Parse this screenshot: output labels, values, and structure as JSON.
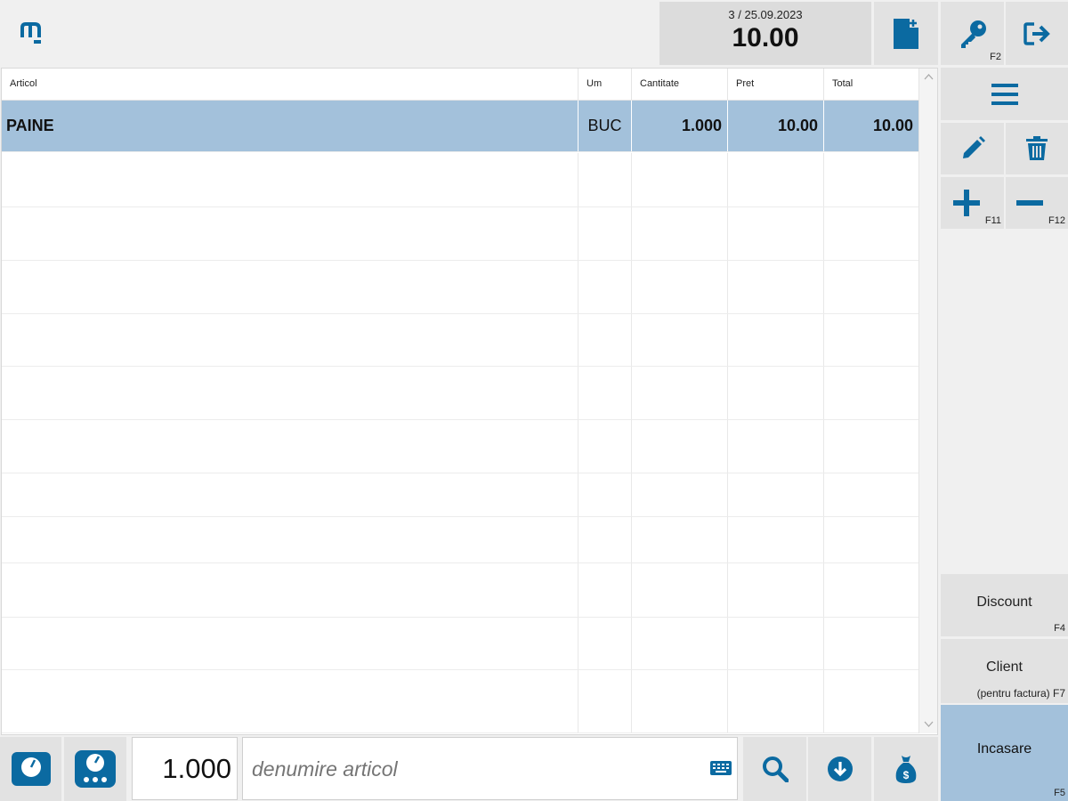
{
  "header": {
    "receipt_info": "3 / 25.09.2023",
    "total": "10.00",
    "logo_icon": "m-logo-icon",
    "new_doc_icon": "new-document-icon",
    "key_icon": "key-icon",
    "key_fkey": "F2",
    "logout_icon": "logout-icon"
  },
  "table": {
    "columns": [
      "Articol",
      "Um",
      "Cantitate",
      "Pret",
      "Total"
    ],
    "rows": [
      {
        "articol": "PAINE",
        "um": "BUC",
        "cantitate": "1.000",
        "pret": "10.00",
        "total": "10.00"
      }
    ]
  },
  "side": {
    "menu_icon": "menu-icon",
    "edit_icon": "pencil-icon",
    "delete_icon": "trash-icon",
    "plus_fkey": "F11",
    "minus_fkey": "F12",
    "discount_label": "Discount",
    "discount_fkey": "F4",
    "client_label": "Client",
    "client_sub": "(pentru factura) F7",
    "incasare_label": "Incasare",
    "incasare_fkey": "F5"
  },
  "bottom": {
    "quantity": "1.000",
    "search_placeholder": "denumire articol",
    "scale_icon": "scale-icon",
    "scale_multi_icon": "scale-multi-icon",
    "keyboard_icon": "keyboard-icon",
    "search_icon": "search-icon",
    "down_icon": "arrow-down-circle-icon",
    "bag_icon": "money-bag-icon"
  },
  "colors": {
    "accent": "#0b6aa1",
    "selected_row": "#a3c1db",
    "incasare_bg": "#a3c1db",
    "button_bg": "#e2e2e2"
  }
}
